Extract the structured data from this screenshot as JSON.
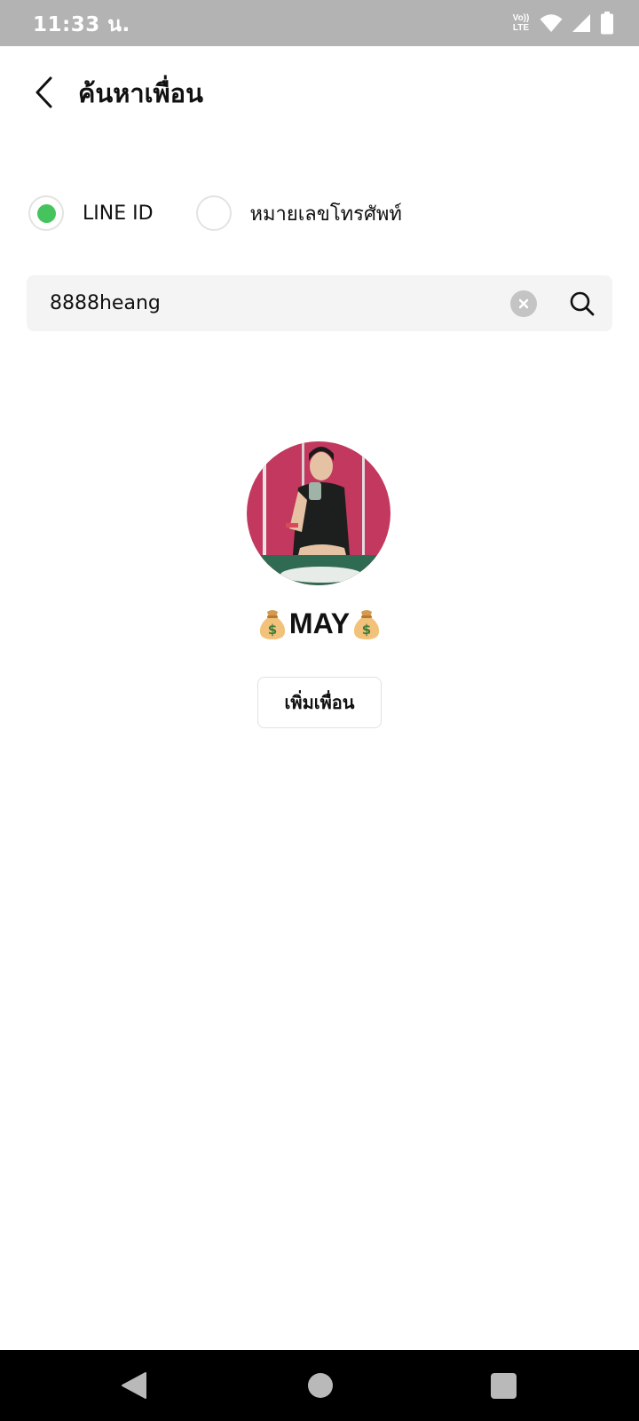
{
  "status_bar": {
    "time": "11:33 น.",
    "lte_top": "Vo))",
    "lte_bottom": "LTE",
    "icons": [
      "volte-icon",
      "wifi-icon",
      "signal-icon",
      "battery-icon"
    ]
  },
  "header": {
    "back_icon": "chevron-left-icon",
    "title": "ค้นหาเพื่อน"
  },
  "search_type": {
    "options": [
      {
        "label": "LINE ID",
        "selected": true
      },
      {
        "label": "หมายเลขโทรศัพท์",
        "selected": false
      }
    ]
  },
  "search": {
    "value": "8888heang",
    "clear_icon": "clear-icon",
    "search_icon": "search-icon"
  },
  "result": {
    "name": "MAY",
    "name_decoration_icon": "money-bag-icon",
    "add_button_label": "เพิ่มเพื่อน"
  },
  "colors": {
    "accent": "#45c45e",
    "status_bar": "#b3b3b3",
    "search_bg": "#f4f4f4"
  },
  "nav": {
    "icons": [
      "nav-back-icon",
      "nav-home-icon",
      "nav-recents-icon"
    ]
  }
}
